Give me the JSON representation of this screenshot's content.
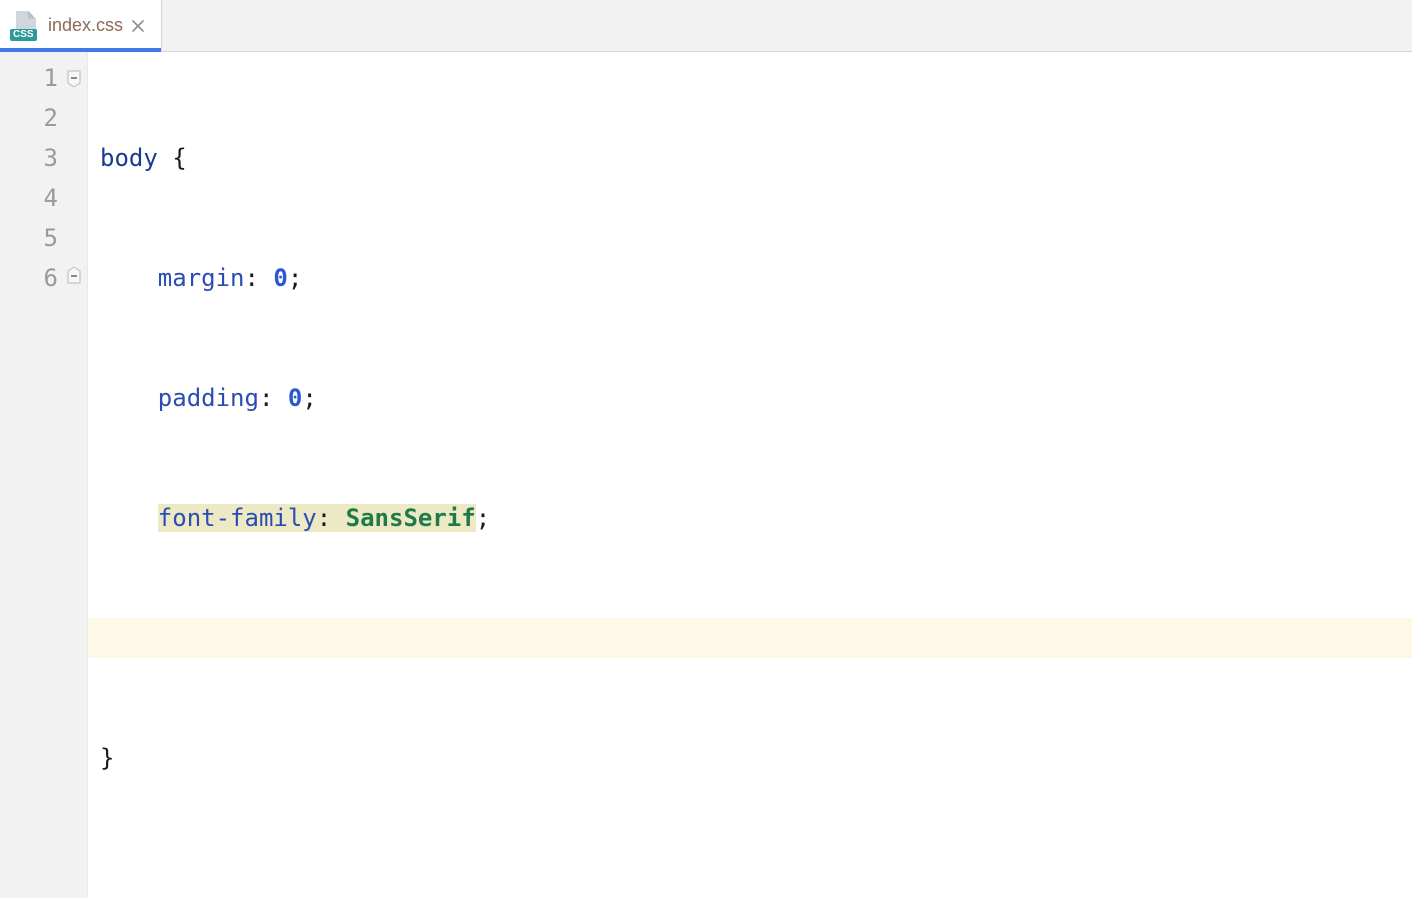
{
  "tab": {
    "filename": "index.css",
    "icon_label": "CSS"
  },
  "editor": {
    "line_count": 6,
    "current_line": 5,
    "fold_open_line": 1,
    "fold_close_line": 6,
    "line_numbers": [
      "1",
      "2",
      "3",
      "4",
      "5",
      "6"
    ],
    "code": {
      "l1": {
        "selector": "body",
        "space": " ",
        "brace_open": "{"
      },
      "l2": {
        "indent": "    ",
        "prop": "margin",
        "colon_sp": ": ",
        "val": "0",
        "semi": ";"
      },
      "l3": {
        "indent": "    ",
        "prop": "padding",
        "colon_sp": ": ",
        "val": "0",
        "semi": ";"
      },
      "l4": {
        "indent": "    ",
        "prop": "font-family",
        "colon_sp": ": ",
        "val": "SansSerif",
        "semi": ";"
      },
      "l6": {
        "brace_close": "}"
      }
    }
  }
}
